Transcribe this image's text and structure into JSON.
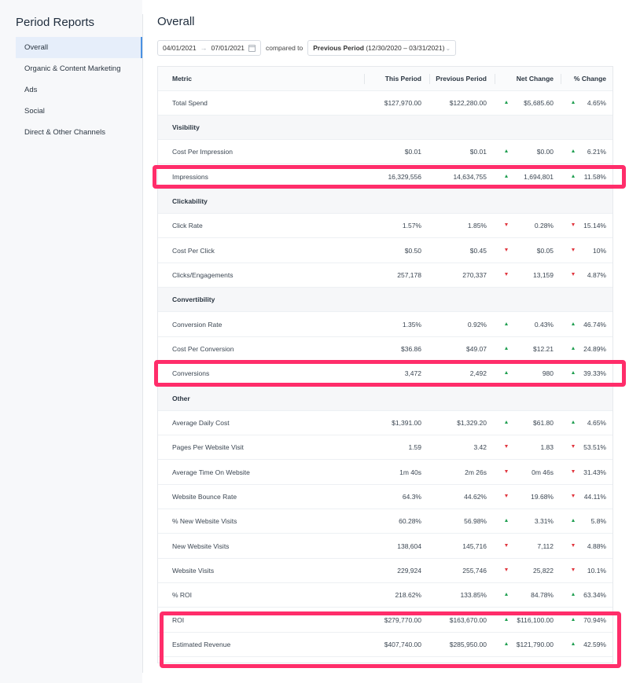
{
  "sidebar": {
    "title": "Period Reports",
    "items": [
      {
        "label": "Overall",
        "active": true
      },
      {
        "label": "Organic & Content Marketing",
        "active": false
      },
      {
        "label": "Ads",
        "active": false
      },
      {
        "label": "Social",
        "active": false
      },
      {
        "label": "Direct & Other Channels",
        "active": false
      }
    ]
  },
  "main": {
    "title": "Overall",
    "filters": {
      "start_date": "04/01/2021",
      "end_date": "07/01/2021",
      "compared_to": "compared to",
      "period_label": "Previous Period",
      "period_range": "(12/30/2020 – 03/31/2021)"
    },
    "table": {
      "headers": [
        "Metric",
        "This Period",
        "Previous Period",
        "Net Change",
        "% Change"
      ],
      "rows": [
        {
          "type": "data",
          "metric": "Total Spend",
          "this": "$127,970.00",
          "prev": "$122,280.00",
          "net": "$5,685.60",
          "pct": "4.65%",
          "net_dir": "up",
          "pct_dir": "up"
        },
        {
          "type": "section",
          "metric": "Visibility"
        },
        {
          "type": "data",
          "metric": "Cost Per Impression",
          "this": "$0.01",
          "prev": "$0.01",
          "net": "$0.00",
          "pct": "6.21%",
          "net_dir": "up",
          "pct_dir": "up"
        },
        {
          "type": "data",
          "metric": "Impressions",
          "this": "16,329,556",
          "prev": "14,634,755",
          "net": "1,694,801",
          "pct": "11.58%",
          "net_dir": "up",
          "pct_dir": "up"
        },
        {
          "type": "section",
          "metric": "Clickability"
        },
        {
          "type": "data",
          "metric": "Click Rate",
          "this": "1.57%",
          "prev": "1.85%",
          "net": "0.28%",
          "pct": "15.14%",
          "net_dir": "down",
          "pct_dir": "down"
        },
        {
          "type": "data",
          "metric": "Cost Per Click",
          "this": "$0.50",
          "prev": "$0.45",
          "net": "$0.05",
          "pct": "10%",
          "net_dir": "down",
          "pct_dir": "down"
        },
        {
          "type": "data",
          "metric": "Clicks/Engagements",
          "this": "257,178",
          "prev": "270,337",
          "net": "13,159",
          "pct": "4.87%",
          "net_dir": "down",
          "pct_dir": "down"
        },
        {
          "type": "section",
          "metric": "Convertibility"
        },
        {
          "type": "data",
          "metric": "Conversion Rate",
          "this": "1.35%",
          "prev": "0.92%",
          "net": "0.43%",
          "pct": "46.74%",
          "net_dir": "up",
          "pct_dir": "up"
        },
        {
          "type": "data",
          "metric": "Cost Per Conversion",
          "this": "$36.86",
          "prev": "$49.07",
          "net": "$12.21",
          "pct": "24.89%",
          "net_dir": "up",
          "pct_dir": "up"
        },
        {
          "type": "data",
          "metric": "Conversions",
          "this": "3,472",
          "prev": "2,492",
          "net": "980",
          "pct": "39.33%",
          "net_dir": "up",
          "pct_dir": "up"
        },
        {
          "type": "section",
          "metric": "Other"
        },
        {
          "type": "data",
          "metric": "Average Daily Cost",
          "this": "$1,391.00",
          "prev": "$1,329.20",
          "net": "$61.80",
          "pct": "4.65%",
          "net_dir": "up",
          "pct_dir": "up"
        },
        {
          "type": "data",
          "metric": "Pages Per Website Visit",
          "this": "1.59",
          "prev": "3.42",
          "net": "1.83",
          "pct": "53.51%",
          "net_dir": "down",
          "pct_dir": "down"
        },
        {
          "type": "data",
          "metric": "Average Time On Website",
          "this": "1m 40s",
          "prev": "2m 26s",
          "net": "0m 46s",
          "pct": "31.43%",
          "net_dir": "down",
          "pct_dir": "down"
        },
        {
          "type": "data",
          "metric": "Website Bounce Rate",
          "this": "64.3%",
          "prev": "44.62%",
          "net": "19.68%",
          "pct": "44.11%",
          "net_dir": "down",
          "pct_dir": "down"
        },
        {
          "type": "data",
          "metric": "% New Website Visits",
          "this": "60.28%",
          "prev": "56.98%",
          "net": "3.31%",
          "pct": "5.8%",
          "net_dir": "up",
          "pct_dir": "up"
        },
        {
          "type": "data",
          "metric": "New Website Visits",
          "this": "138,604",
          "prev": "145,716",
          "net": "7,112",
          "pct": "4.88%",
          "net_dir": "down",
          "pct_dir": "down"
        },
        {
          "type": "data",
          "metric": "Website Visits",
          "this": "229,924",
          "prev": "255,746",
          "net": "25,822",
          "pct": "10.1%",
          "net_dir": "down",
          "pct_dir": "down"
        },
        {
          "type": "data",
          "metric": "% ROI",
          "this": "218.62%",
          "prev": "133.85%",
          "net": "84.78%",
          "pct": "63.34%",
          "net_dir": "up",
          "pct_dir": "up"
        },
        {
          "type": "data",
          "metric": "ROI",
          "this": "$279,770.00",
          "prev": "$163,670.00",
          "net": "$116,100.00",
          "pct": "70.94%",
          "net_dir": "up",
          "pct_dir": "up"
        },
        {
          "type": "data",
          "metric": "Estimated Revenue",
          "this": "$407,740.00",
          "prev": "$285,950.00",
          "net": "$121,790.00",
          "pct": "42.59%",
          "net_dir": "up",
          "pct_dir": "up"
        }
      ]
    }
  },
  "colors": {
    "up": "#1e9e4f",
    "down": "#e0353d",
    "highlight": "#ff2d6a",
    "active_nav_bg": "#e6eefa",
    "active_nav_border": "#4a90e2"
  }
}
